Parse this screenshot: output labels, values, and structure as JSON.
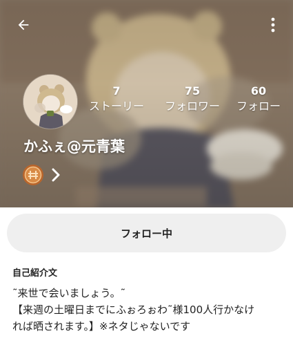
{
  "header": {
    "back_icon": "arrow-left-icon",
    "menu_icon": "more-vert-icon"
  },
  "profile": {
    "avatar_icon": "avatar-image",
    "username": "かふぇ@元青葉",
    "badge_icon": "coin-badge-icon",
    "chevron_icon": "chevron-right-icon"
  },
  "stats": [
    {
      "count": "7",
      "label": "ストーリー"
    },
    {
      "count": "75",
      "label": "フォロワー"
    },
    {
      "count": "60",
      "label": "フォロー"
    }
  ],
  "follow_button": {
    "label": "フォロー中"
  },
  "bio": {
    "title": "自己紹介文",
    "lines": [
      "˜来世で会いましょう。˜",
      "【来週の土曜日までにふぉろぉわ˜様100人行かなけ",
      "れば晒されます。】※ネタじゃないです"
    ]
  },
  "colors": {
    "header_bg": "#8f7e6c",
    "follow_button_bg": "#efefef",
    "text": "#222222"
  }
}
